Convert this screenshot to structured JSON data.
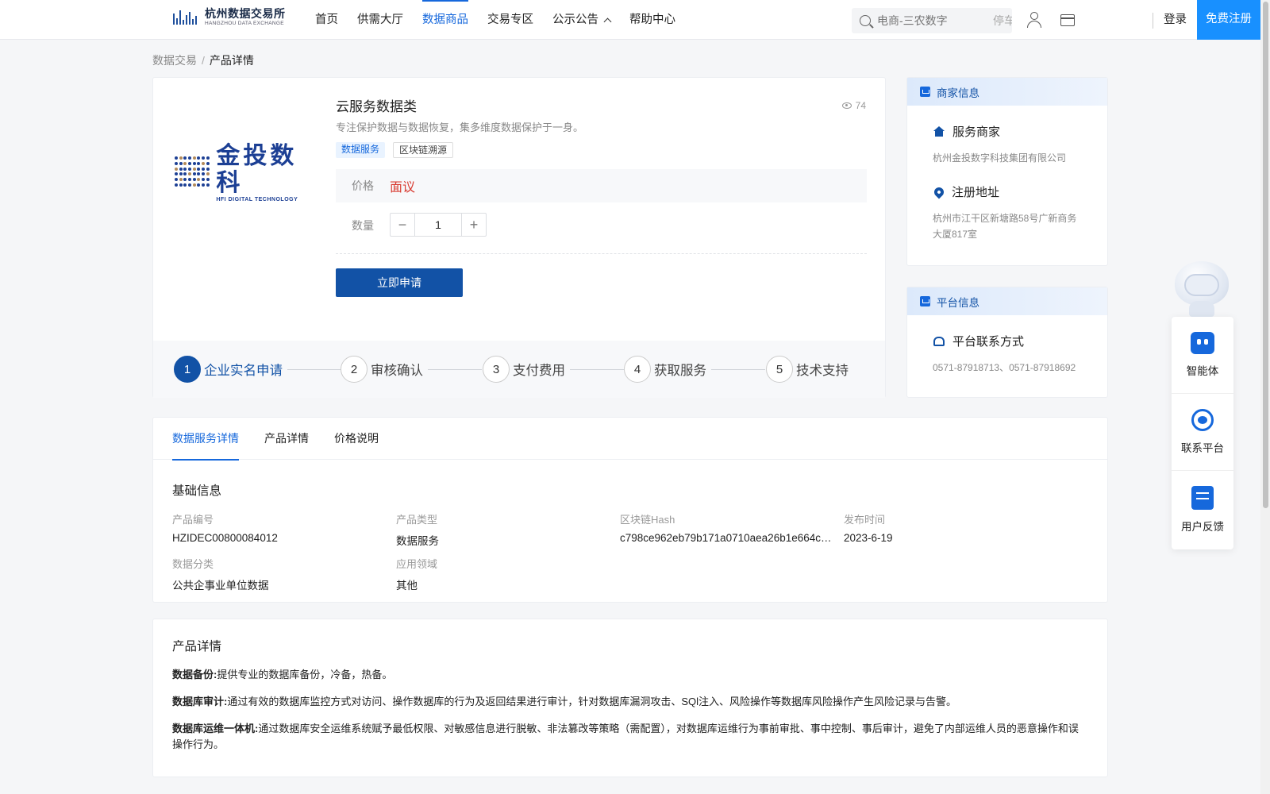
{
  "header": {
    "logo_cn": "杭州数据交易所",
    "logo_en": "HANGZHOU DATA EXCHANGE",
    "nav": [
      {
        "label": "首页",
        "active": false
      },
      {
        "label": "供需大厅",
        "active": false
      },
      {
        "label": "数据商品",
        "active": true
      },
      {
        "label": "交易专区",
        "active": false
      },
      {
        "label": "公示公告",
        "active": false,
        "has_dropdown": true
      },
      {
        "label": "帮助中心",
        "active": false
      }
    ],
    "search_placeholder": "电商-三农数字",
    "search_hint2": "停车",
    "login": "登录",
    "register": "免费注册"
  },
  "breadcrumb": {
    "parent": "数据交易",
    "sep": "/",
    "current": "产品详情"
  },
  "product": {
    "brand_cn": "金投数科",
    "brand_en": "HFI DIGITAL TECHNOLOGY",
    "title": "云服务数据类",
    "views": "74",
    "description": "专注保护数据与数据恢复，集多维度数据保护于一身。",
    "tags": [
      "数据服务",
      "区块链溯源"
    ],
    "price_label": "价格",
    "price_value": "面议",
    "qty_label": "数量",
    "qty_minus": "−",
    "qty_value": "1",
    "qty_plus": "+",
    "apply_button": "立即申请",
    "steps": [
      {
        "num": "1",
        "label": "企业实名申请",
        "active": true
      },
      {
        "num": "2",
        "label": "审核确认",
        "active": false
      },
      {
        "num": "3",
        "label": "支付费用",
        "active": false
      },
      {
        "num": "4",
        "label": "获取服务",
        "active": false
      },
      {
        "num": "5",
        "label": "技术支持",
        "active": false
      }
    ]
  },
  "merchant": {
    "header": "商家信息",
    "service_title": "服务商家",
    "service_value": "杭州金投数字科技集团有限公司",
    "address_title": "注册地址",
    "address_value": "杭州市江干区新塘路58号广新商务大厦817室"
  },
  "platform": {
    "header": "平台信息",
    "contact_title": "平台联系方式",
    "contact_value": "0571-87918713、0571-87918692"
  },
  "float_panel": [
    "智能体",
    "联系平台",
    "用户反馈"
  ],
  "detail": {
    "tabs": [
      {
        "label": "数据服务详情",
        "active": true
      },
      {
        "label": "产品详情",
        "active": false
      },
      {
        "label": "价格说明",
        "active": false
      }
    ],
    "section_title": "基础信息",
    "fields": [
      {
        "label": "产品编号",
        "value": "HZIDEC00800084012"
      },
      {
        "label": "产品类型",
        "value": "数据服务"
      },
      {
        "label": "区块链Hash",
        "value": "c798ce962eb79b171a0710aea26b1e664c…"
      },
      {
        "label": "发布时间",
        "value": "2023-6-19"
      },
      {
        "label": "数据分类",
        "value": "公共企事业单位数据"
      },
      {
        "label": "应用领域",
        "value": "其他"
      }
    ]
  },
  "product_detail": {
    "title": "产品详情",
    "paragraphs": [
      {
        "term": "数据备份:",
        "text": "提供专业的数据库备份，冷备，热备。"
      },
      {
        "term": "数据库审计:",
        "text": "通过有效的数据库监控方式对访问、操作数据库的行为及返回结果进行审计，针对数据库漏洞攻击、SQl注入、风险操作等数据库风险操作产生风险记录与告警。"
      },
      {
        "term": "数据库运维一体机:",
        "text": "通过数据库安全运维系统赋予最低权限、对敏感信息进行脱敏、非法篡改等策略（需配置），对数据库运维行为事前审批、事中控制、事后审计，避免了内部运维人员的恶意操作和误操作行为。"
      }
    ]
  }
}
